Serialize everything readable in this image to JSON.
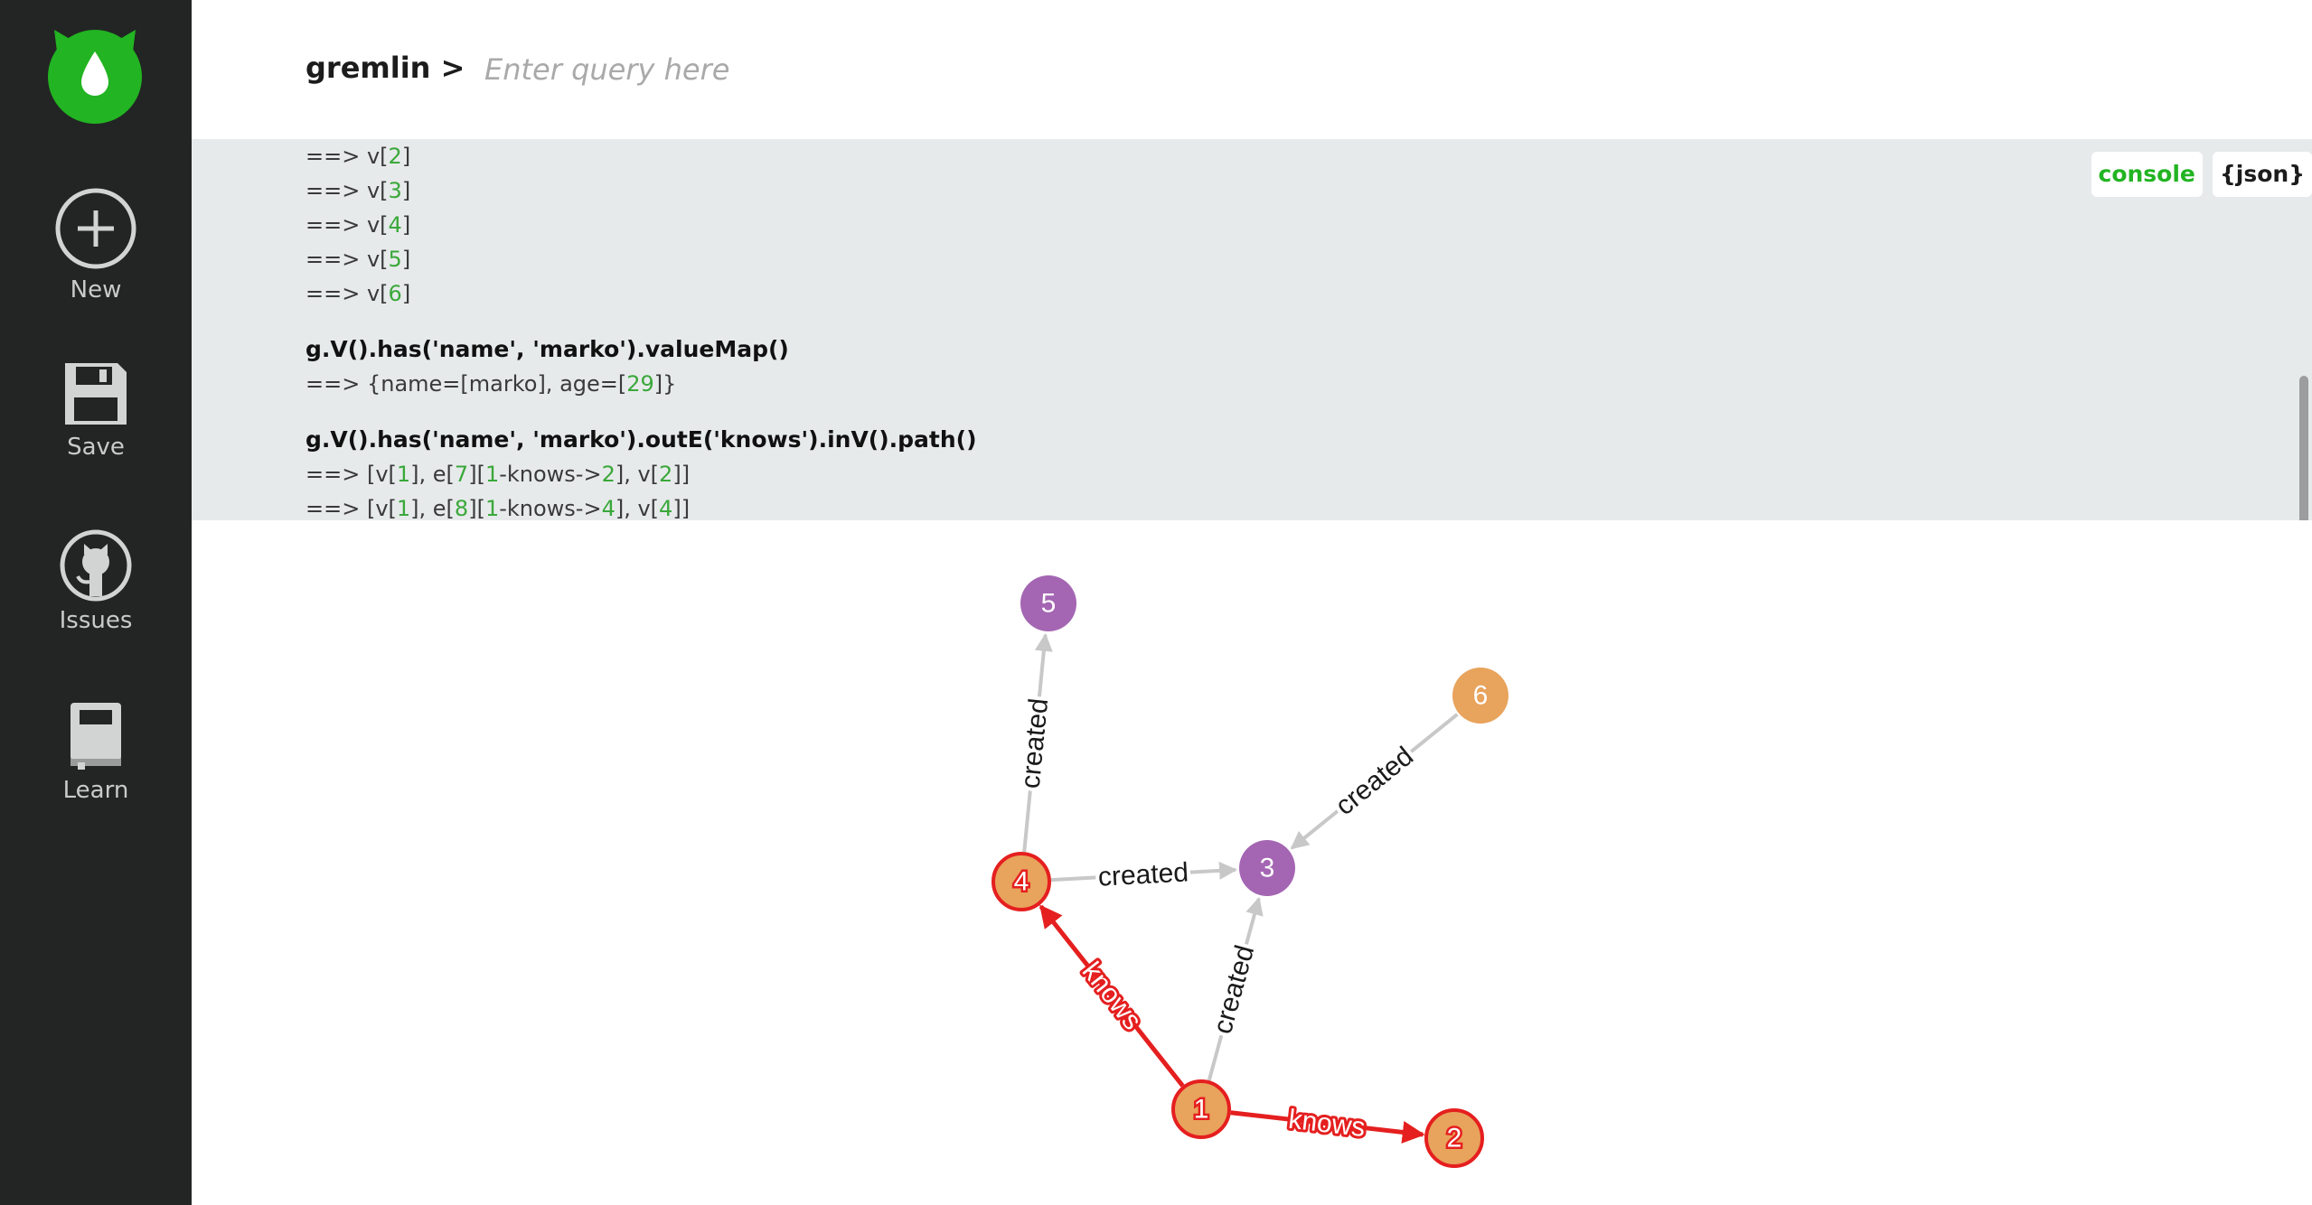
{
  "sidebar": {
    "items": [
      {
        "label": "New",
        "icon": "plus-circle-icon"
      },
      {
        "label": "Save",
        "icon": "floppy-disk-icon"
      },
      {
        "label": "Issues",
        "icon": "github-octocat-icon"
      },
      {
        "label": "Learn",
        "icon": "book-icon"
      }
    ],
    "logo_icon": "drop-logo-icon",
    "accent": "#22b422"
  },
  "header": {
    "prompt": "gremlin >",
    "query_placeholder": "Enter query here",
    "query_value": ""
  },
  "console": {
    "toggle": {
      "console_label": "console",
      "json_label": "{json}",
      "active": "console"
    },
    "lines": [
      {
        "kind": "result",
        "parts": [
          [
            "==> v[",
            ""
          ],
          [
            "2",
            "n"
          ],
          [
            "]",
            ""
          ]
        ]
      },
      {
        "kind": "result",
        "parts": [
          [
            "==> v[",
            ""
          ],
          [
            "3",
            "n"
          ],
          [
            "]",
            ""
          ]
        ]
      },
      {
        "kind": "result",
        "parts": [
          [
            "==> v[",
            ""
          ],
          [
            "4",
            "n"
          ],
          [
            "]",
            ""
          ]
        ]
      },
      {
        "kind": "result",
        "parts": [
          [
            "==> v[",
            ""
          ],
          [
            "5",
            "n"
          ],
          [
            "]",
            ""
          ]
        ]
      },
      {
        "kind": "result",
        "parts": [
          [
            "==> v[",
            ""
          ],
          [
            "6",
            "n"
          ],
          [
            "]",
            ""
          ]
        ]
      },
      {
        "kind": "gap"
      },
      {
        "kind": "cmd",
        "parts": [
          [
            "g.V().has('name', 'marko').valueMap()",
            ""
          ]
        ]
      },
      {
        "kind": "result",
        "parts": [
          [
            "==> {name=[marko], age=[",
            ""
          ],
          [
            "29",
            "n"
          ],
          [
            "]}",
            ""
          ]
        ]
      },
      {
        "kind": "gap"
      },
      {
        "kind": "cmd",
        "parts": [
          [
            "g.V().has('name', 'marko').outE('knows').inV().path()",
            ""
          ]
        ]
      },
      {
        "kind": "result",
        "parts": [
          [
            "==> [v[",
            ""
          ],
          [
            "1",
            "n"
          ],
          [
            "], e[",
            ""
          ],
          [
            "7",
            "n"
          ],
          [
            "][",
            ""
          ],
          [
            "1",
            "n"
          ],
          [
            "-knows->",
            ""
          ],
          [
            "2",
            "n"
          ],
          [
            "], v[",
            ""
          ],
          [
            "2",
            "n"
          ],
          [
            "]]",
            ""
          ]
        ]
      },
      {
        "kind": "result",
        "parts": [
          [
            "==> [v[",
            ""
          ],
          [
            "1",
            "n"
          ],
          [
            "], e[",
            ""
          ],
          [
            "8",
            "n"
          ],
          [
            "][",
            ""
          ],
          [
            "1",
            "n"
          ],
          [
            "-knows->",
            ""
          ],
          [
            "4",
            "n"
          ],
          [
            "], v[",
            ""
          ],
          [
            "4",
            "n"
          ],
          [
            "]]",
            ""
          ]
        ]
      }
    ]
  },
  "graph": {
    "colors": {
      "person": "#e8a35c",
      "software": "#a466b3",
      "highlight": "#e51f1f",
      "edge": "#c8c8c8",
      "label": "#1a1a1a"
    },
    "nodes": [
      {
        "id": "1",
        "type": "person",
        "highlighted": true
      },
      {
        "id": "2",
        "type": "person",
        "highlighted": true
      },
      {
        "id": "3",
        "type": "software",
        "highlighted": false
      },
      {
        "id": "4",
        "type": "person",
        "highlighted": true
      },
      {
        "id": "5",
        "type": "software",
        "highlighted": false
      },
      {
        "id": "6",
        "type": "person",
        "highlighted": false
      }
    ],
    "edges": [
      {
        "from": "1",
        "to": "2",
        "label": "knows",
        "highlighted": true
      },
      {
        "from": "1",
        "to": "4",
        "label": "knows",
        "highlighted": true
      },
      {
        "from": "1",
        "to": "3",
        "label": "created",
        "highlighted": false
      },
      {
        "from": "4",
        "to": "3",
        "label": "created",
        "highlighted": false
      },
      {
        "from": "4",
        "to": "5",
        "label": "created",
        "highlighted": false
      },
      {
        "from": "6",
        "to": "3",
        "label": "created",
        "highlighted": false
      }
    ]
  }
}
